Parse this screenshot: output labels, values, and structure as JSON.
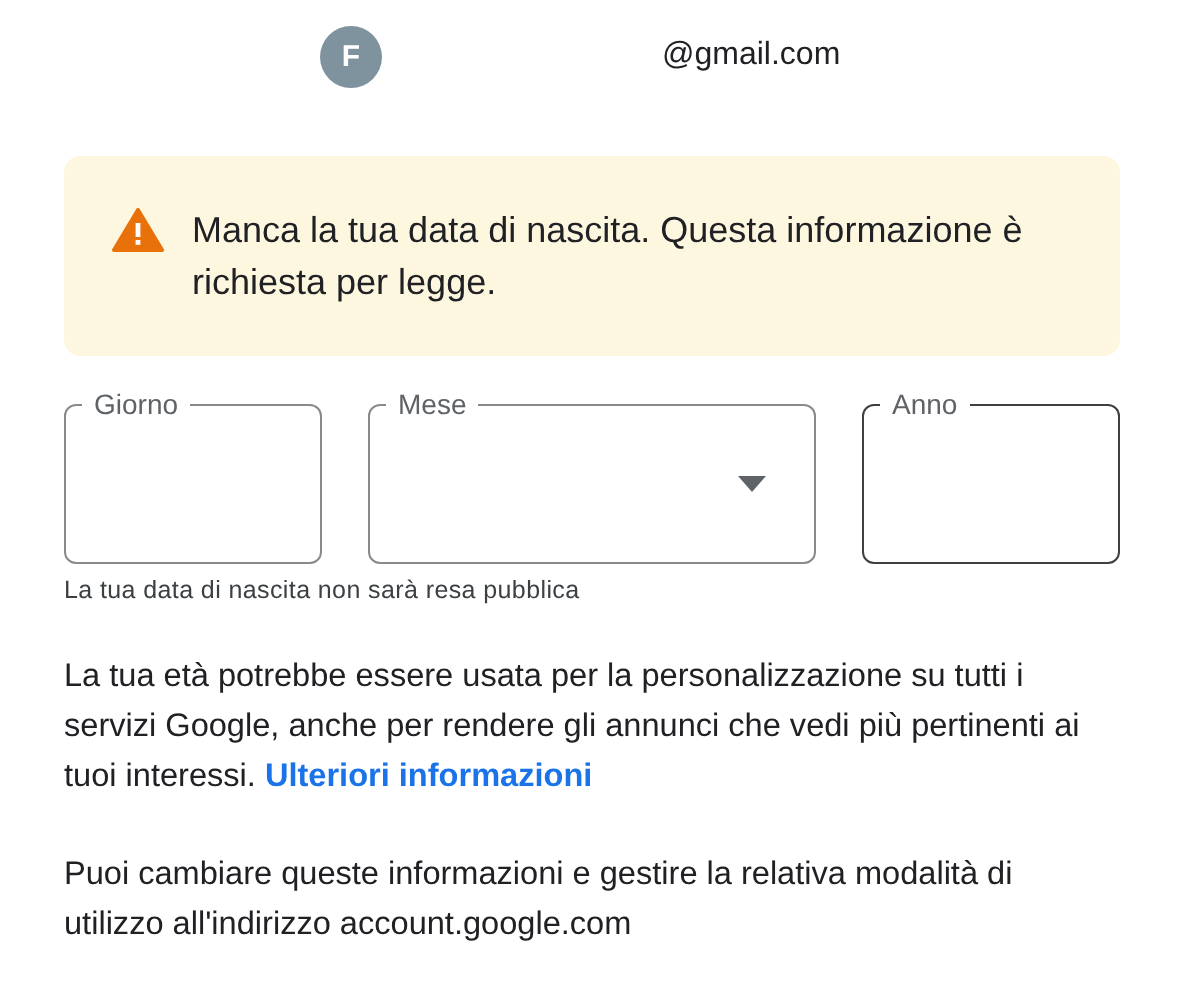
{
  "account": {
    "avatar_letter": "F",
    "email": "@gmail.com"
  },
  "alert": {
    "kind": "warning",
    "message": "Manca la tua data di nascita. Questa informazione è richiesta per legge."
  },
  "birthdate_fields": [
    {
      "label": "Giorno",
      "kind": "text",
      "focused": false
    },
    {
      "label": "Mese",
      "kind": "select",
      "focused": false
    },
    {
      "label": "Anno",
      "kind": "text",
      "focused": true
    }
  ],
  "birthdate_hint": "La tua data di nascita non sarà resa pubblica",
  "info_paragraph": {
    "text": "La tua età potrebbe essere usata per la personalizzazione su tutti i servizi Google, anche per rendere gli annunci che vedi più pertinenti ai tuoi interessi.",
    "link": "Ulteriori informazioni"
  },
  "manage_paragraph": "Puoi cambiare queste informazioni e gestire la relativa modalità di utilizzo all'indirizzo account.google.com"
}
